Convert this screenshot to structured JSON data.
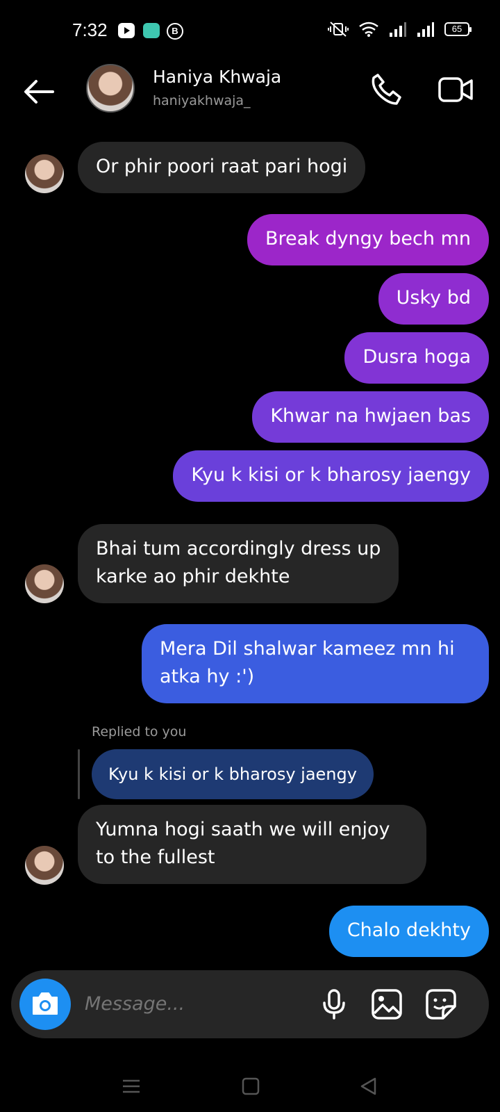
{
  "status_bar": {
    "time": "7:32",
    "battery": "65",
    "app_icons": [
      "youtube-icon",
      "messages-app-icon",
      "b-app-icon"
    ],
    "system_icons": [
      "vibrate-icon",
      "wifi-icon",
      "signal-icon",
      "signal-icon",
      "battery-icon"
    ]
  },
  "header": {
    "name": "Haniya Khwaja",
    "handle": "haniyakhwaja_"
  },
  "colors": {
    "incoming_bubble": "#262626",
    "outgoing_gradient_top": "#9c27c8",
    "outgoing_gradient_bottom": "#3b5de0",
    "reply_bubble": "#1e3a73",
    "camera_button": "#1d8ff2"
  },
  "messages": [
    {
      "from": "them",
      "text": "Or phir poori raat pari hogi"
    },
    {
      "from": "me",
      "text": "Break dyngy bech mn"
    },
    {
      "from": "me",
      "text": "Usky bd"
    },
    {
      "from": "me",
      "text": "Dusra hoga"
    },
    {
      "from": "me",
      "text": "Khwar na hwjaen bas"
    },
    {
      "from": "me",
      "text": "Kyu k kisi or k bharosy jaengy"
    },
    {
      "from": "them",
      "text_line1": "Bhai tum accordingly dress up",
      "text_line2": "karke ao phir dekhte"
    },
    {
      "from": "me",
      "text_line1": "Mera Dil shalwar kameez mn hi",
      "text_line2": "atka hy :')"
    },
    {
      "from": "them",
      "reply_label": "Replied to you",
      "quoted": "Kyu k kisi or k bharosy jaengy",
      "text_line1": "Yumna hogi saath we will enjoy",
      "text_line2": "to the fullest"
    },
    {
      "from": "me",
      "text": "Chalo dekhty"
    }
  ],
  "composer": {
    "placeholder": "Message..."
  }
}
